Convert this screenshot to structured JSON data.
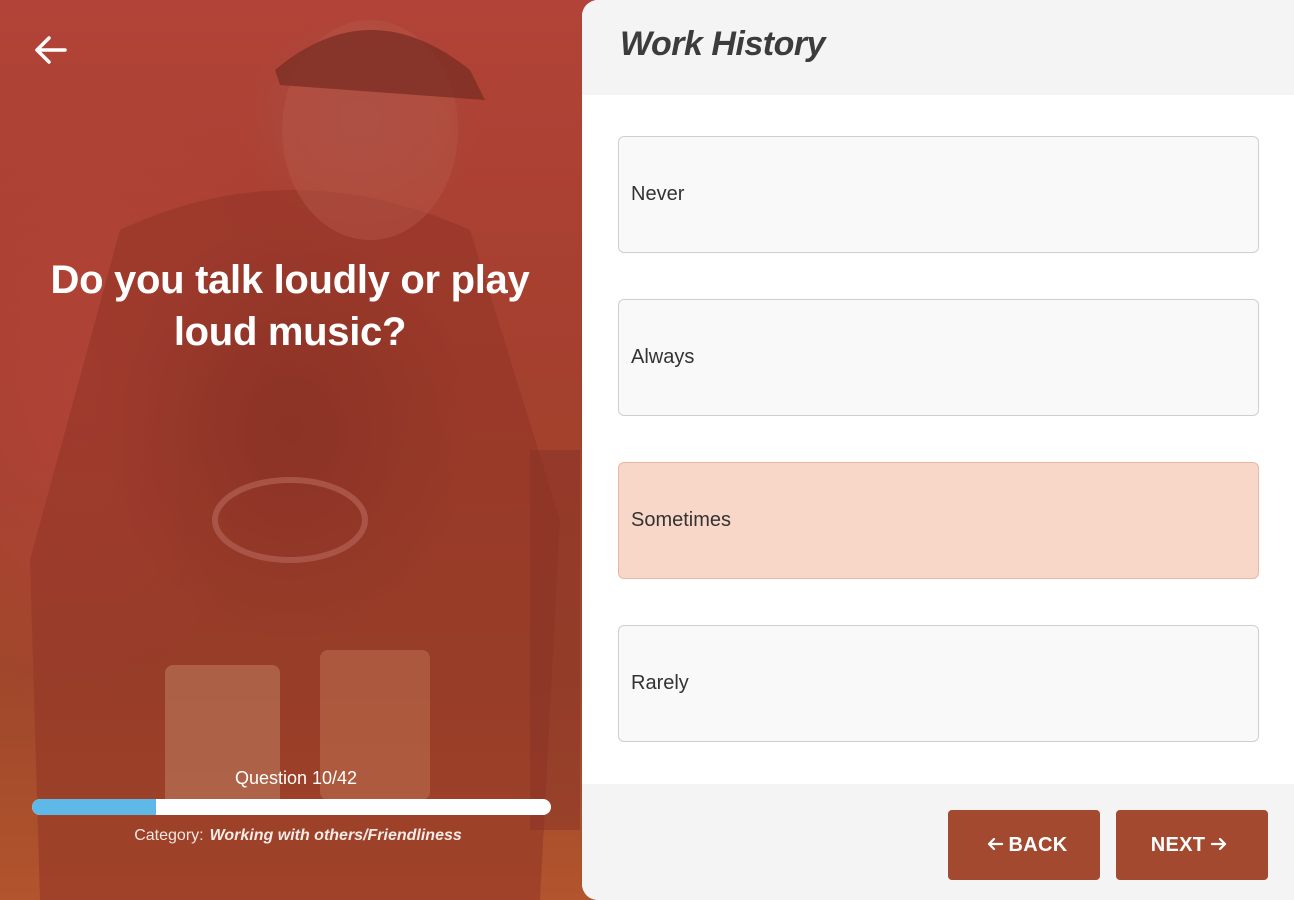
{
  "question_panel": {
    "question": "Do you talk loudly or play loud music?",
    "progress": {
      "label": "Question 10/42",
      "current": 10,
      "total": 42
    },
    "category_label": "Category:",
    "category_value": "Working with others/Friendliness"
  },
  "section": {
    "title": "Work History"
  },
  "options": [
    {
      "label": "Never",
      "selected": false
    },
    {
      "label": "Always",
      "selected": false
    },
    {
      "label": "Sometimes",
      "selected": true
    },
    {
      "label": "Rarely",
      "selected": false
    }
  ],
  "footer": {
    "back_label": "BACK",
    "next_label": "NEXT"
  },
  "colors": {
    "accent": "#a3492f",
    "selected_option": "#f9d7c8",
    "progress_fill": "#5fb9e8",
    "overlay": "#a8453a"
  }
}
